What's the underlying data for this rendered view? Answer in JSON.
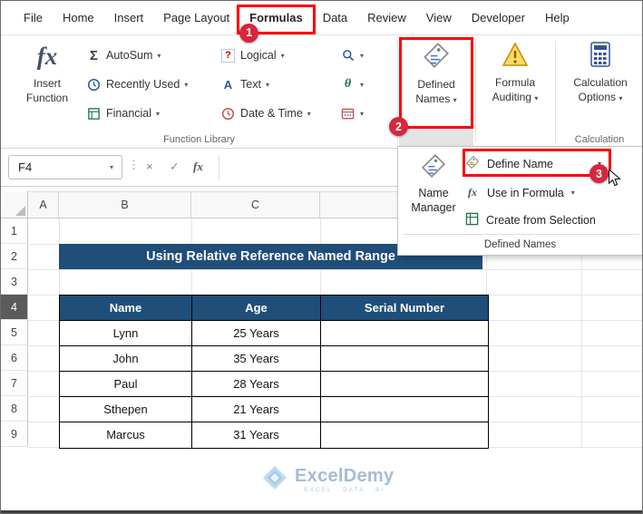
{
  "annotations": {
    "step1": "1",
    "step2": "2",
    "step3": "3"
  },
  "colors": {
    "header_blue": "#1F4E79",
    "annotation_red": "#FF0000",
    "badge_red": "#D7263D",
    "watermark_blue": "#9FB9D8"
  },
  "icons": {
    "chevron": "▾",
    "sigma": "Σ",
    "question": "?",
    "letter_a": "A",
    "theta": "θ",
    "fx": "fx",
    "cancel": "×",
    "check": "✓",
    "dots": "⋮"
  },
  "menu": {
    "tabs": [
      {
        "label": "File"
      },
      {
        "label": "Home"
      },
      {
        "label": "Insert"
      },
      {
        "label": "Page Layout"
      },
      {
        "label": "Formulas"
      },
      {
        "label": "Data"
      },
      {
        "label": "Review"
      },
      {
        "label": "View"
      },
      {
        "label": "Developer"
      },
      {
        "label": "Help"
      }
    ]
  },
  "ribbon": {
    "insert_function": {
      "line1": "Insert",
      "line2": "Function"
    },
    "buttons": {
      "autosum": "AutoSum",
      "recently_used": "Recently Used",
      "financial": "Financial",
      "logical": "Logical",
      "text": "Text",
      "date_time": "Date & Time"
    },
    "function_library_label": "Function Library",
    "defined_names": {
      "line1": "Defined",
      "line2": "Names"
    },
    "formula_auditing": {
      "line1": "Formula",
      "line2": "Auditing"
    },
    "calculation_options": {
      "line1": "Calculation",
      "line2": "Options"
    },
    "calculation_group_label": "Calculation"
  },
  "formula_bar": {
    "name_box_value": "F4"
  },
  "dropdown_menu": {
    "name_manager": {
      "line1": "Name",
      "line2": "Manager"
    },
    "items": [
      {
        "label": "Define Name"
      },
      {
        "label": "Use in Formula"
      },
      {
        "label": "Create from Selection"
      }
    ],
    "footer_label": "Defined Names"
  },
  "sheet": {
    "column_headers": [
      "A",
      "B",
      "C"
    ],
    "row_headers": [
      "1",
      "2",
      "3",
      "4",
      "5",
      "6",
      "7",
      "8",
      "9"
    ],
    "selected_row": "4",
    "banner_title": "Using Relative Reference Named Range",
    "table": {
      "headers": [
        "Name",
        "Age",
        "Serial Number"
      ],
      "rows": [
        [
          "Lynn",
          "25 Years",
          ""
        ],
        [
          "John",
          "35 Years",
          ""
        ],
        [
          "Paul",
          "28 Years",
          ""
        ],
        [
          "Sthepen",
          "21 Years",
          ""
        ],
        [
          "Marcus",
          "31 Years",
          ""
        ]
      ]
    }
  },
  "watermark": {
    "brand": "ExcelDemy",
    "tagline": "EXCEL · DATA · BI"
  }
}
